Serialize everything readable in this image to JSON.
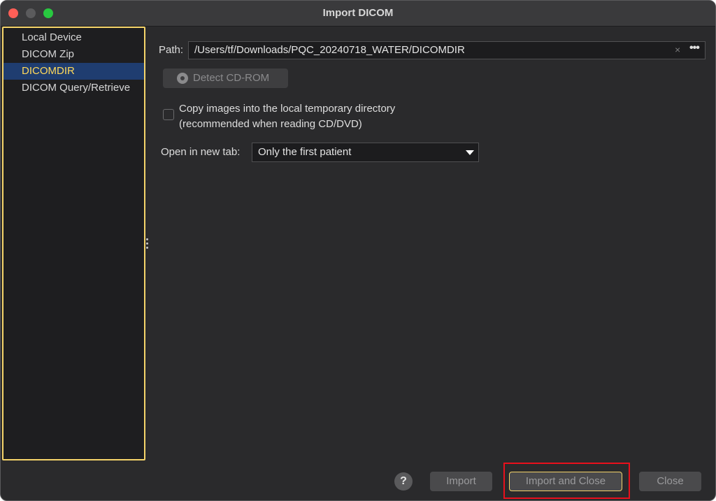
{
  "window": {
    "title": "Import DICOM"
  },
  "sidebar": {
    "items": [
      {
        "label": "Local Device"
      },
      {
        "label": "DICOM Zip"
      },
      {
        "label": "DICOMDIR",
        "selected": true
      },
      {
        "label": "DICOM Query/Retrieve"
      }
    ]
  },
  "path": {
    "label": "Path:",
    "value": "/Users/tf/Downloads/PQC_20240718_WATER/DICOMDIR",
    "clear_glyph": "×",
    "more_glyph": "•••"
  },
  "detect": {
    "label": "Detect CD-ROM",
    "icon": "cd-icon"
  },
  "copy_option": {
    "line1": "Copy images into the local temporary directory",
    "line2": "(recommended when reading CD/DVD)",
    "checked": false
  },
  "open_tab": {
    "label": "Open in new tab:",
    "selected": "Only the first patient"
  },
  "footer": {
    "help_glyph": "?",
    "import_label": "Import",
    "import_close_label": "Import and Close",
    "close_label": "Close"
  },
  "colors": {
    "highlight_yellow": "#f5d46a",
    "annotation_red": "#e8101c",
    "selection_blue": "#1f3d70"
  }
}
